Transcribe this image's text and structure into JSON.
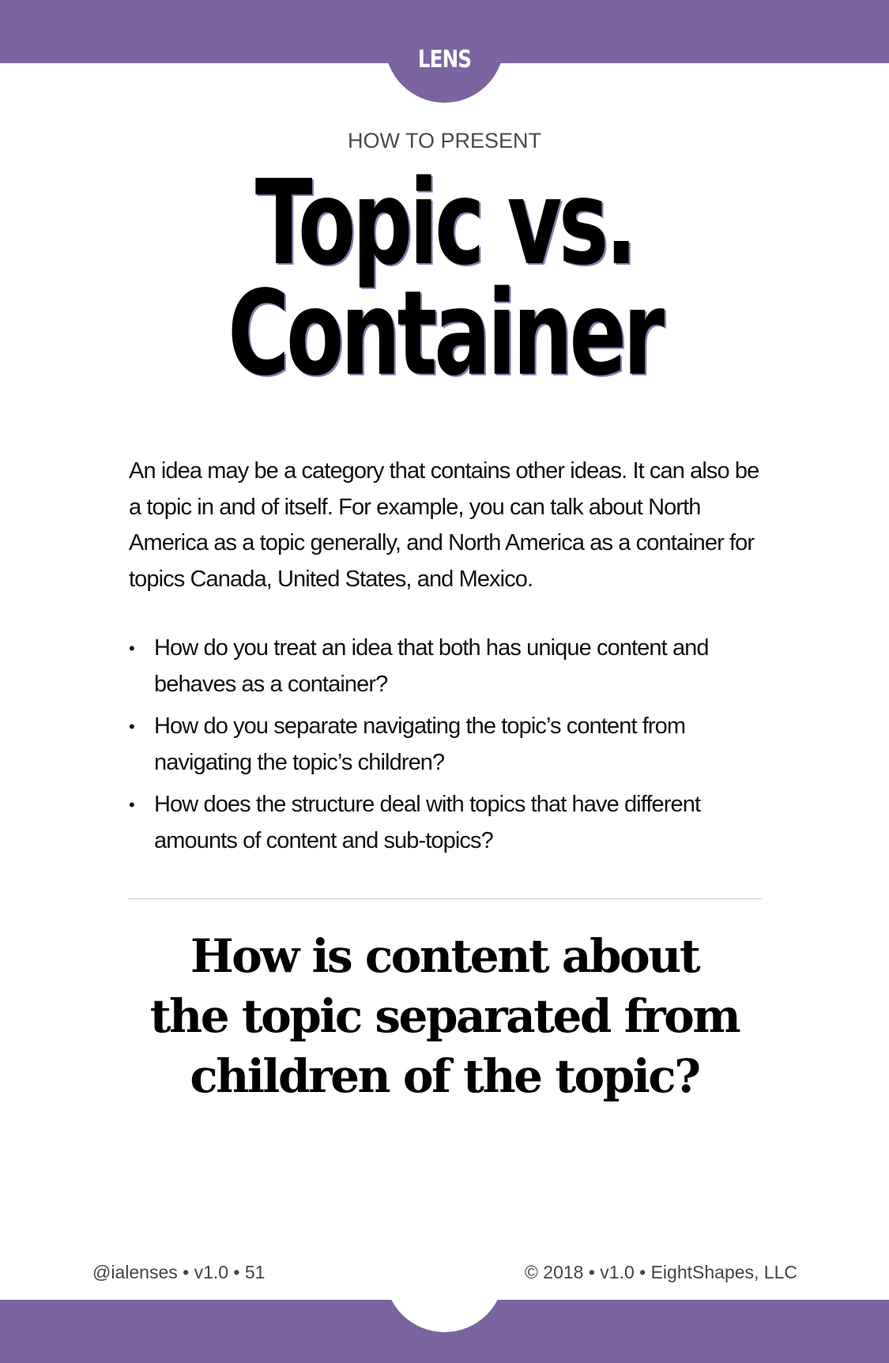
{
  "colors": {
    "brand_purple": "#7b64a0",
    "title_shadow": "#8e7ab0",
    "text": "#111111"
  },
  "header": {
    "tab_label": "LENS"
  },
  "eyebrow": "HOW TO PRESENT",
  "title": {
    "line1": "Topic vs.",
    "line2": "Container"
  },
  "body": {
    "paragraph": "An idea may be a category that contains other ideas. It can also be a topic in and of itself. For example, you can talk about North America as a topic generally, and North America as a container for topics Canada, United States, and Mexico.",
    "bullets": [
      "How do you treat an idea that both has unique content and behaves as a container?",
      "How do you separate navigating the topic’s content from navigating the topic’s children?",
      "How does the structure deal with topics that have different amounts of content and sub-topics?"
    ]
  },
  "question": {
    "line1": "How is content about",
    "line2": "the topic separated from",
    "line3": "children of the topic?"
  },
  "footer": {
    "left": "@ialenses • v1.0 •  51",
    "right": "© 2018 • v1.0 • EightShapes, LLC"
  }
}
